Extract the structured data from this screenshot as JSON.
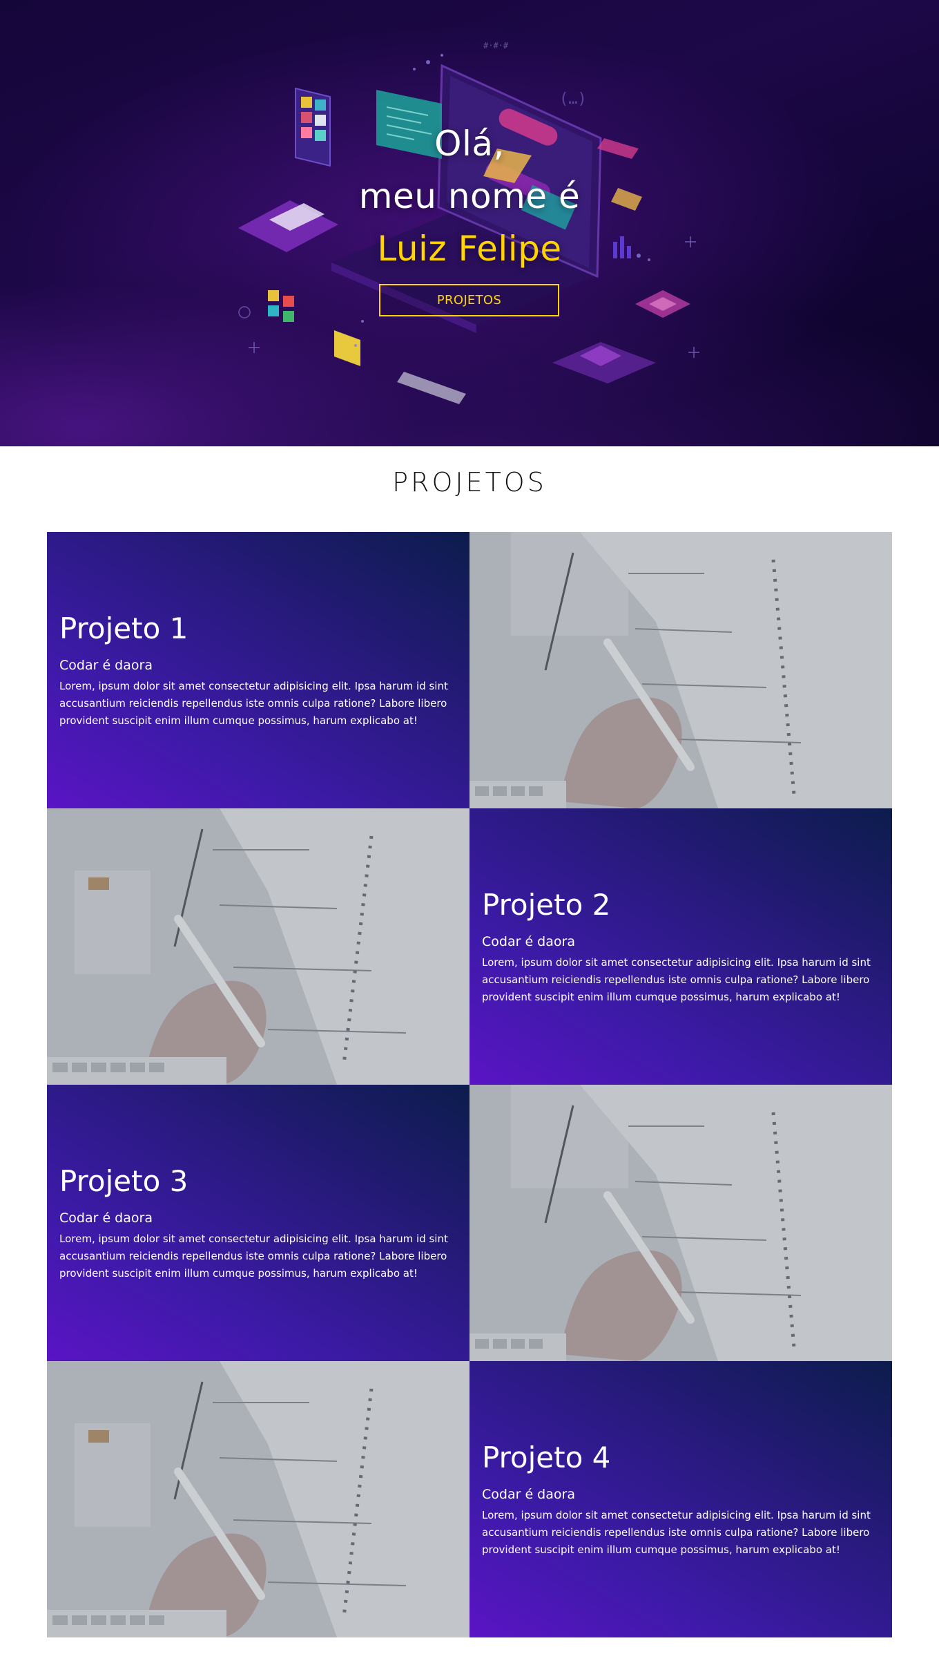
{
  "hero": {
    "line1": "Olá,",
    "line2": "meu nome é",
    "name": "Luiz Felipe",
    "button_label": "PROJETOS"
  },
  "projects_section": {
    "title": "PROJETOS",
    "items": [
      {
        "title": "Projeto 1",
        "subtitle": "Codar é daora",
        "description": "Lorem, ipsum dolor sit amet consectetur adipisicing elit. Ipsa harum id sint accusantium reiciendis repellendus iste omnis culpa ratione? Labore libero provident suscipit enim illum cumque possimus, harum explicabo at!"
      },
      {
        "title": "Projeto 2",
        "subtitle": "Codar é daora",
        "description": "Lorem, ipsum dolor sit amet consectetur adipisicing elit. Ipsa harum id sint accusantium reiciendis repellendus iste omnis culpa ratione? Labore libero provident suscipit enim illum cumque possimus, harum explicabo at!"
      },
      {
        "title": "Projeto 3",
        "subtitle": "Codar é daora",
        "description": "Lorem, ipsum dolor sit amet consectetur adipisicing elit. Ipsa harum id sint accusantium reiciendis repellendus iste omnis culpa ratione? Labore libero provident suscipit enim illum cumque possimus, harum explicabo at!"
      },
      {
        "title": "Projeto 4",
        "subtitle": "Codar é daora",
        "description": "Lorem, ipsum dolor sit amet consectetur adipisicing elit. Ipsa harum id sint accusantium reiciendis repellendus iste omnis culpa ratione? Labore libero provident suscipit enim illum cumque possimus, harum explicabo at!"
      }
    ]
  },
  "colors": {
    "accent": "#ffd400",
    "hero_background": "#1a0742",
    "card_gradient_start": "#5a14c4",
    "card_gradient_end": "#0c1c4c"
  },
  "images": {
    "hero_illustration": "isometric-tech-illustration",
    "project_image": "notebook-writing-photo"
  }
}
